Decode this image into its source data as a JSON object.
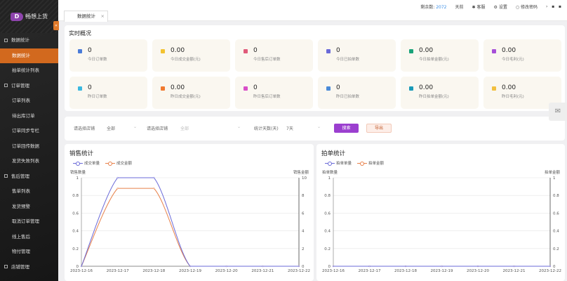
{
  "app": {
    "logo_text": "畅想上货",
    "tab": "数据统计"
  },
  "header": {
    "remain_label": "剩余数:",
    "remain_value": "2072",
    "remain_unit": "天前",
    "service": "客服",
    "settings": "设置",
    "password": "修改密码"
  },
  "sidebar": {
    "items": [
      {
        "label": "数据统计",
        "group": true
      },
      {
        "label": "数据统计",
        "active": true
      },
      {
        "label": "拍单统计列表"
      },
      {
        "label": "订单管理",
        "group": true
      },
      {
        "label": "订单列表"
      },
      {
        "label": "待出库订单"
      },
      {
        "label": "订单同步专栏"
      },
      {
        "label": "订单回传数据"
      },
      {
        "label": "发货失败列表"
      },
      {
        "label": "售后管理",
        "group": true
      },
      {
        "label": "售单列表"
      },
      {
        "label": "发货预警"
      },
      {
        "label": "取消订单管理"
      },
      {
        "label": "线上售后"
      },
      {
        "label": "物付管理"
      },
      {
        "label": "店铺管理",
        "group": true
      }
    ]
  },
  "overview": {
    "title": "实时概况",
    "cards": [
      {
        "value": "0",
        "label": "今日订单数",
        "color": "#4a7bd8"
      },
      {
        "value": "0.00",
        "label": "今日成交金额(元)",
        "color": "#f2c230"
      },
      {
        "value": "0",
        "label": "今日售后订单数",
        "color": "#e05a7a"
      },
      {
        "value": "0",
        "label": "今日已拍单数",
        "color": "#6a6ad8"
      },
      {
        "value": "0.00",
        "label": "今日拍单金额(元)",
        "color": "#1aa37a"
      },
      {
        "value": "0.00",
        "label": "今日毛利(元)",
        "color": "#a64fd8"
      },
      {
        "value": "0",
        "label": "昨日订单数",
        "color": "#3ab8e0"
      },
      {
        "value": "0.00",
        "label": "昨日成交金额(元)",
        "color": "#f07a30"
      },
      {
        "value": "0",
        "label": "昨日售后订单数",
        "color": "#d84fc8"
      },
      {
        "value": "0",
        "label": "昨日已拍单数",
        "color": "#4a8ad8"
      },
      {
        "value": "0.00",
        "label": "昨日拍单金额(元)",
        "color": "#1a9ab8"
      },
      {
        "value": "0.00",
        "label": "昨日毛利(元)",
        "color": "#f2c040"
      }
    ]
  },
  "filters": {
    "shop_label": "请选择店铺",
    "shop_value": "全部",
    "store_label": "请选择店铺",
    "store_value": "全部",
    "days_label": "统计天数(天)",
    "days_value": "7天",
    "search": "搜索",
    "export": "导出"
  },
  "chart_data": [
    {
      "type": "line",
      "title": "销售统计",
      "x": [
        "2023-12-16",
        "2023-12-17",
        "2023-12-18",
        "2023-12-19",
        "2023-12-20",
        "2023-12-21",
        "2023-12-22"
      ],
      "ylabel": "销售数量",
      "ylabel_right": "销售金额",
      "ylim": [
        0,
        1
      ],
      "ylim_right": [
        0,
        10
      ],
      "yticks": [
        "0",
        "0.2",
        "0.4",
        "0.6",
        "0.8",
        "1"
      ],
      "yticks_right": [
        "0",
        "2",
        "4",
        "6",
        "8",
        "10"
      ],
      "grid": true,
      "legend": "top-left",
      "series": [
        {
          "name": "成交单量",
          "axis": "left",
          "color": "#6a6ad8",
          "values": [
            0,
            1,
            1,
            0,
            0,
            0,
            0
          ]
        },
        {
          "name": "成交金额",
          "axis": "right",
          "color": "#e8814a",
          "values": [
            0,
            8.8,
            8.8,
            0,
            0,
            0,
            0
          ]
        }
      ]
    },
    {
      "type": "line",
      "title": "拍单统计",
      "x": [
        "2023-12-16",
        "2023-12-17",
        "2023-12-18",
        "2023-12-19",
        "2023-12-20",
        "2023-12-21",
        "2023-12-22"
      ],
      "ylabel": "拍单数量",
      "ylabel_right": "拍单金额",
      "ylim": [
        0,
        1
      ],
      "ylim_right": [
        0,
        1
      ],
      "yticks": [
        "0",
        "0.2",
        "0.4",
        "0.6",
        "0.8",
        "1"
      ],
      "yticks_right": [
        "0",
        "0.2",
        "0.4",
        "0.6",
        "0.8",
        "1"
      ],
      "grid": true,
      "legend": "top-left",
      "series": [
        {
          "name": "拍单单量",
          "axis": "left",
          "color": "#6a6ad8",
          "values": [
            0,
            0,
            0,
            0,
            0,
            0,
            0
          ]
        },
        {
          "name": "拍单金额",
          "axis": "right",
          "color": "#e8814a",
          "values": [
            0,
            0,
            0,
            0,
            0,
            0,
            0
          ]
        }
      ]
    }
  ]
}
